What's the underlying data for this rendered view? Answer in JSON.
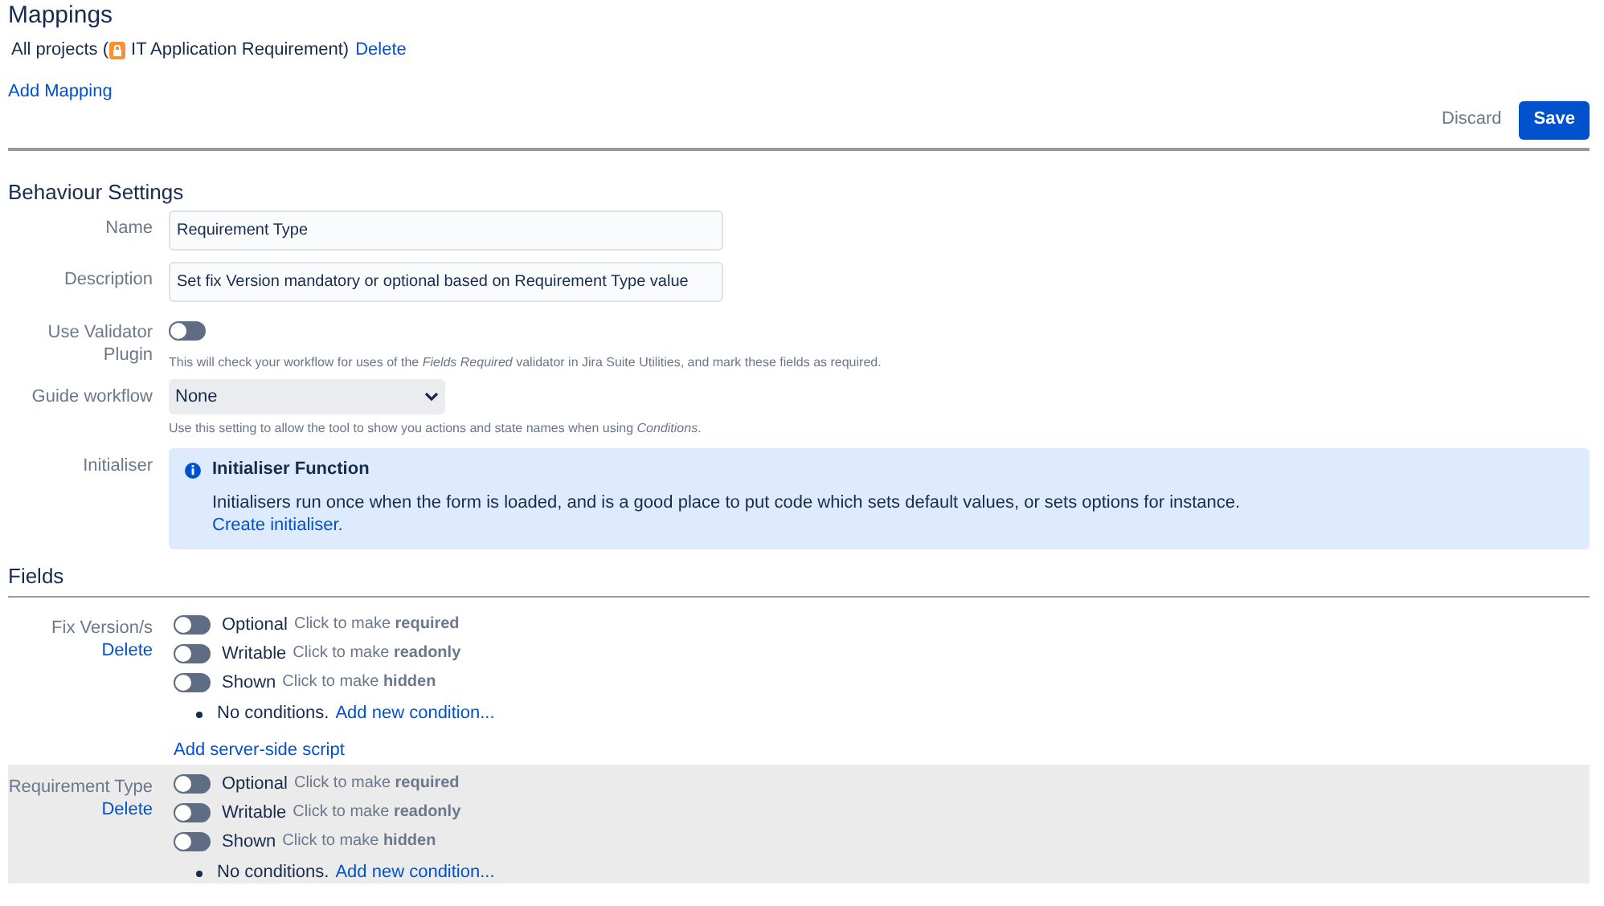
{
  "mappings": {
    "title": "Mappings",
    "items": [
      {
        "scope": "All projects (",
        "project": "IT Application Requirement)",
        "delete": "Delete"
      }
    ],
    "add_link": "Add Mapping"
  },
  "actions": {
    "discard": "Discard",
    "save": "Save"
  },
  "behaviour": {
    "title": "Behaviour Settings",
    "name": {
      "label": "Name",
      "value": "Requirement Type"
    },
    "description": {
      "label": "Description",
      "value": "Set fix Version mandatory or optional based on Requirement Type value"
    },
    "validator": {
      "label": "Use Validator Plugin",
      "on": false,
      "help": "This will check your workflow for uses of the *Fields Required* validator in Jira Suite Utilities, and mark these fields as required."
    },
    "guide": {
      "label": "Guide workflow",
      "value": "None",
      "help": "Use this setting to allow the tool to show you actions and state names when using *Conditions*."
    },
    "initialiser": {
      "label": "Initialiser",
      "title": "Initialiser Function",
      "text": "Initialisers run once when the form is loaded, and is a good place to put code which sets default values, or sets options for instance.",
      "link": "Create initialiser."
    }
  },
  "fields": {
    "title": "Fields",
    "items": [
      {
        "name": "Fix Version/s",
        "delete": "Delete",
        "highlighted": false,
        "toggles": [
          {
            "state": "Optional",
            "hint": "Click to make **required**",
            "on": false
          },
          {
            "state": "Writable",
            "hint": "Click to make **readonly**",
            "on": false
          },
          {
            "state": "Shown",
            "hint": "Click to make **hidden**",
            "on": false
          }
        ],
        "conditions": "No conditions.",
        "add_condition": "Add new condition...",
        "script_link": "Add server-side script"
      },
      {
        "name": "Requirement Type",
        "delete": "Delete",
        "highlighted": true,
        "toggles": [
          {
            "state": "Optional",
            "hint": "Click to make **required**",
            "on": false
          },
          {
            "state": "Writable",
            "hint": "Click to make **readonly**",
            "on": false
          },
          {
            "state": "Shown",
            "hint": "Click to make **hidden**",
            "on": false
          }
        ],
        "conditions": "No conditions.",
        "add_condition": "Add new condition..."
      }
    ]
  }
}
